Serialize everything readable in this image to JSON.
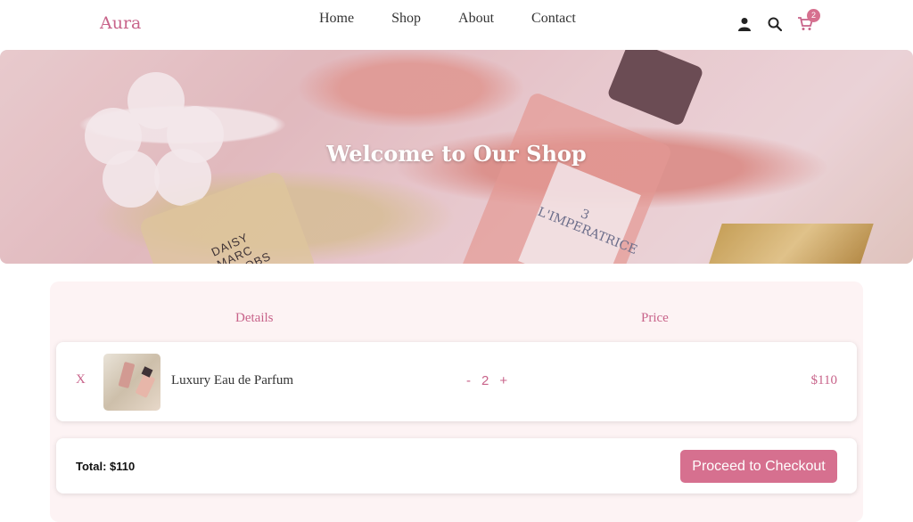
{
  "nav": {
    "logo": "Aura",
    "links": [
      "Home",
      "Shop",
      "About",
      "Contact"
    ],
    "icons": {
      "account": "user-icon",
      "search": "search-icon",
      "cart": "cart-icon"
    },
    "cart_count": "2"
  },
  "hero": {
    "title": "Welcome to Our Shop",
    "bottle_label": "3 L'IMPERATRICE",
    "bottle_label_2": "DAISY MARC JACOBS"
  },
  "cart": {
    "headers": {
      "details": "Details",
      "price": "Price"
    },
    "items": [
      {
        "remove": "X",
        "name": "Luxury Eau de Parfum",
        "qty_minus": "-",
        "qty": "2",
        "qty_plus": "+",
        "price": "$110"
      }
    ],
    "total": "Total: $110",
    "checkout_label": "Proceed to Checkout"
  },
  "colors": {
    "accent": "#d6708f",
    "accent_text": "#c8638a",
    "cart_bg": "#fdf3f4"
  }
}
